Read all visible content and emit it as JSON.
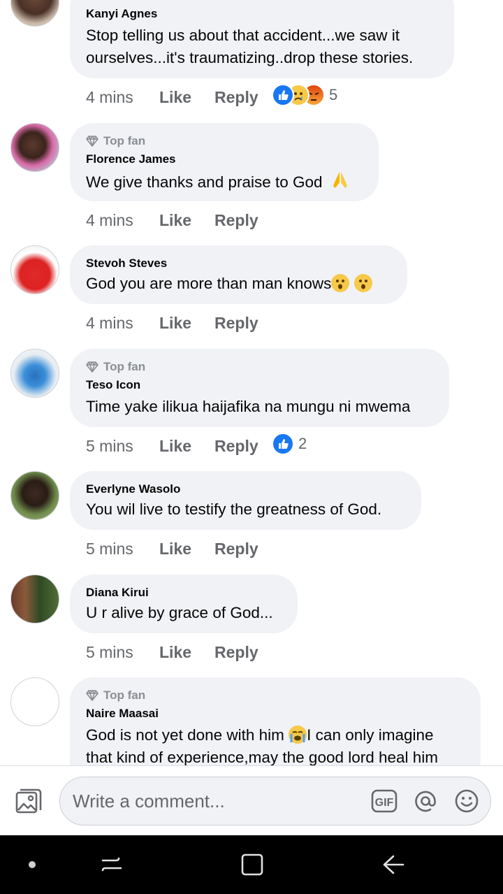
{
  "comments": [
    {
      "author": "Kanyi Agnes",
      "top_fan": "",
      "text": [
        "Stop telling us about that accident...we saw it",
        "ourselves...it's traumatizing..drop these stories."
      ],
      "time": "4 mins",
      "reaction_count": "5",
      "reactions": [
        "like-reaction",
        "sad-reaction",
        "angry-reaction"
      ]
    },
    {
      "author": "Florence James",
      "top_fan": "Top fan",
      "text": [
        "We give thanks and praise to God"
      ],
      "time": "4 mins",
      "reaction_count": "",
      "reactions": []
    },
    {
      "author": "Stevoh Steves",
      "top_fan": "",
      "text": [
        "God you are more than man knows"
      ],
      "time": "4 mins",
      "reaction_count": "",
      "reactions": []
    },
    {
      "author": "Teso Icon",
      "top_fan": "Top fan",
      "text": [
        "Time yake ilikua haijafika na mungu ni mwema"
      ],
      "time": "5 mins",
      "reaction_count": "2",
      "reactions": [
        "like-reaction"
      ]
    },
    {
      "author": "Everlyne Wasolo",
      "top_fan": "",
      "text": [
        "You wil live to testify the greatness of God."
      ],
      "time": "5 mins",
      "reaction_count": "",
      "reactions": []
    },
    {
      "author": "Diana Kirui",
      "top_fan": "",
      "text": [
        "U r alive by grace of God..."
      ],
      "time": "5 mins",
      "reaction_count": "",
      "reactions": []
    },
    {
      "author": "Naire Maasai",
      "top_fan": "Top fan",
      "text": [
        "God is not yet done with him",
        "I can only imagine",
        "that kind of experience,may the good lord heal him"
      ],
      "time": "",
      "reaction_count": "",
      "reactions": []
    }
  ],
  "actions": {
    "like": "Like",
    "reply": "Reply"
  },
  "composer": {
    "placeholder": "Write a comment...",
    "photo_icon": "photo-icon",
    "gif_label": "GIF",
    "mention_icon": "at-icon",
    "emoji_icon": "smiley-icon"
  },
  "navbar": {
    "buttons": [
      "dot-icon",
      "recent-apps-icon",
      "home-icon",
      "back-icon"
    ]
  },
  "colors": {
    "bubble": "#f0f2f5",
    "meta_text": "#65676b",
    "like_blue": "#1877f2",
    "nav_bg": "#000000"
  }
}
